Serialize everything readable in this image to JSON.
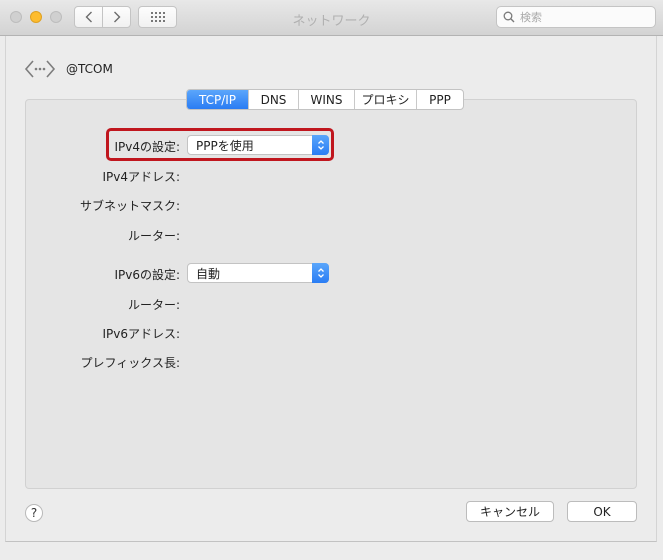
{
  "window": {
    "title": "ネットワーク",
    "search_placeholder": "検索"
  },
  "connection": {
    "name": "@TCOM",
    "icon": "network-connection-icon"
  },
  "tabs": [
    {
      "label": "TCP/IP",
      "active": true
    },
    {
      "label": "DNS",
      "active": false
    },
    {
      "label": "WINS",
      "active": false
    },
    {
      "label": "プロキシ",
      "active": false
    },
    {
      "label": "PPP",
      "active": false
    }
  ],
  "ipv4": {
    "config_label": "IPv4の設定:",
    "config_value": "PPPを使用",
    "address_label": "IPv4アドレス:",
    "subnet_label": "サブネットマスク:",
    "router_label": "ルーター:"
  },
  "ipv6": {
    "config_label": "IPv6の設定:",
    "config_value": "自動",
    "router_label": "ルーター:",
    "address_label": "IPv6アドレス:",
    "prefix_label": "プレフィックス長:"
  },
  "footer": {
    "help_label": "?",
    "cancel_label": "キャンセル",
    "ok_label": "OK"
  },
  "colors": {
    "accent": "#2a7cf3",
    "highlight": "#c0161e"
  }
}
